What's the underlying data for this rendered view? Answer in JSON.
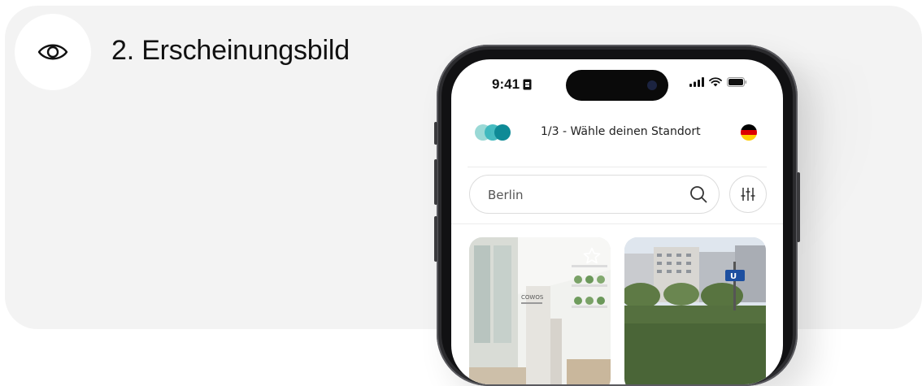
{
  "section": {
    "title": "2. Erscheinungsbild",
    "icon": "eye-icon"
  },
  "phone": {
    "status_bar": {
      "time": "9:41",
      "icons": [
        "sim-card-icon",
        "signal-icon",
        "wifi-icon",
        "battery-icon"
      ]
    },
    "header": {
      "logo": "brand-logo",
      "title": "1/3 - Wähle deinen Standort",
      "language_flag": "germany-flag-icon"
    },
    "search": {
      "value": "Berlin",
      "icon": "search-icon"
    },
    "filter_button": {
      "icon": "filter-sliders-icon"
    },
    "locations": [
      {
        "image": "coworking-interior-photo",
        "favorite_icon": "star-icon"
      },
      {
        "image": "street-buildings-photo"
      }
    ]
  },
  "colors": {
    "card_background": "#f3f3f3",
    "logo_light": "#9ad9d6",
    "logo_mid": "#3bb7bd",
    "logo_dark": "#0e8a96",
    "flag": [
      "#000000",
      "#dd0000",
      "#ffce00"
    ]
  }
}
